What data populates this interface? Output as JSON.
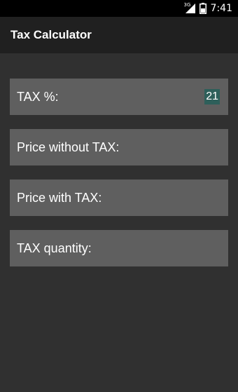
{
  "status_bar": {
    "network_type": "3G",
    "time": "7:41",
    "icons": [
      "signal-icon",
      "battery-icon"
    ]
  },
  "app_bar": {
    "title": "Tax Calculator"
  },
  "fields": [
    {
      "label": "TAX %:",
      "value": "21"
    },
    {
      "label": "Price without TAX:",
      "value": ""
    },
    {
      "label": "Price with TAX:",
      "value": ""
    },
    {
      "label": "TAX quantity:",
      "value": ""
    }
  ],
  "colors": {
    "status_bar": "#000000",
    "app_bar": "#202020",
    "background": "#303030",
    "field_row": "#5f5f5f",
    "input_highlight": "#2e5f5a",
    "text": "#ffffff"
  }
}
